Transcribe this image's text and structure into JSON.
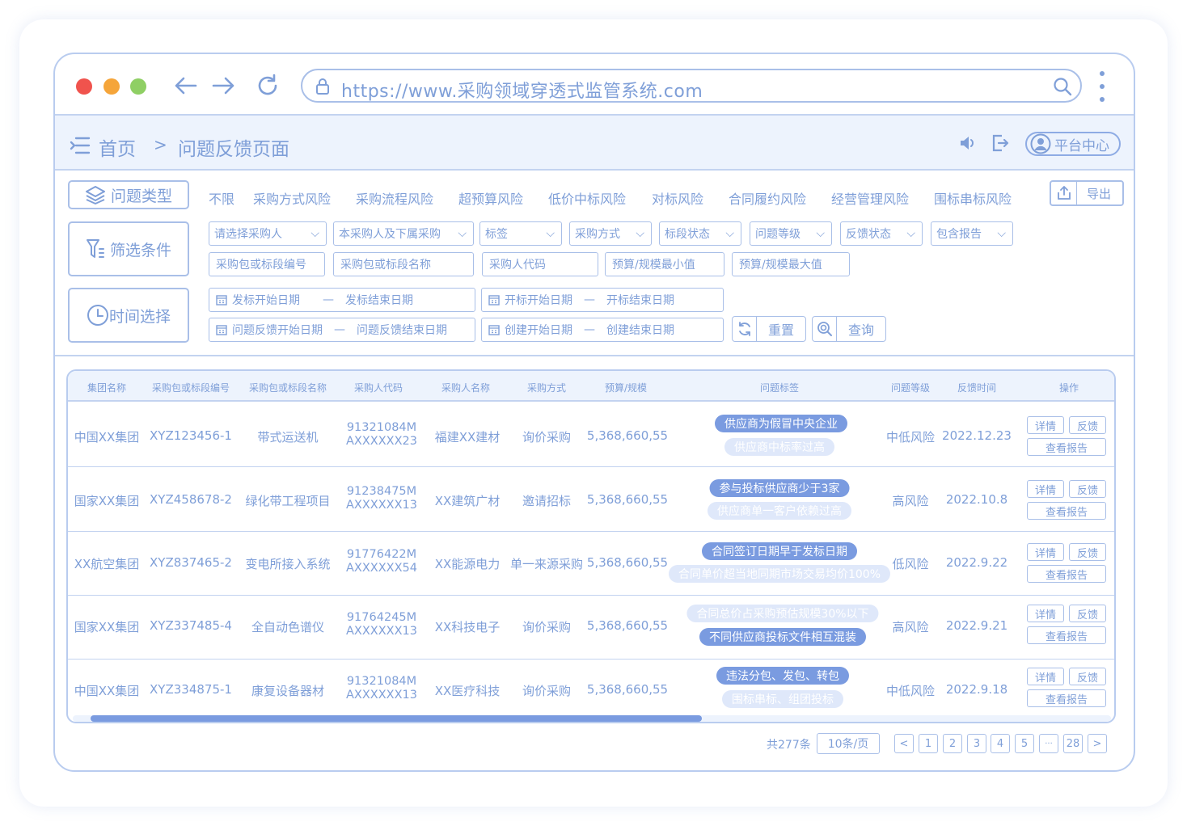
{
  "browser": {
    "url": "https://www.采购领域穿透式监管系统.com",
    "colors": {
      "close": "#f0534d",
      "minimize": "#f5a53a",
      "maximize": "#8fcf64",
      "accent": "#7a9be0"
    }
  },
  "breadcrumb": {
    "home": "首页",
    "separator": ">",
    "current": "问题反馈页面"
  },
  "header": {
    "platform": "平台中心"
  },
  "filters": {
    "problem_type_label": "问题类型",
    "filter_label": "筛选条件",
    "time_label": "时间选择",
    "risk_types": [
      "不限",
      "采购方式风险",
      "采购流程风险",
      "超预算风险",
      "低价中标风险",
      "对标风险",
      "合同履约风险",
      "经营管理风险",
      "围标串标风险"
    ],
    "export_label": "导出",
    "selects": [
      "请选择采购人",
      "本采购人及下属采购",
      "标签",
      "采购方式",
      "标段状态",
      "问题等级",
      "反馈状态",
      "包含报告"
    ],
    "inputs": [
      "采购包或标段编号",
      "采购包或标段名称",
      "采购人代码",
      "预算/规模最小值",
      "预算/规模最大值"
    ],
    "dates": [
      {
        "start": "发标开始日期",
        "end": "发标结束日期"
      },
      {
        "start": "开标开始日期",
        "end": "开标结束日期"
      },
      {
        "start": "问题反馈开始日期",
        "end": "问题反馈结束日期"
      },
      {
        "start": "创建开始日期",
        "end": "创建结束日期"
      }
    ],
    "date_separator": "—",
    "reset_label": "重置",
    "query_label": "查询"
  },
  "table": {
    "headers": [
      "集团名称",
      "采购包或标段编号",
      "采购包或标段名称",
      "采购人代码",
      "采购人名称",
      "采购方式",
      "预算/规模",
      "问题标签",
      "问题等级",
      "反馈时间",
      "操作"
    ],
    "detail_label": "详情",
    "feedback_label": "反馈",
    "report_label": "查看报告",
    "rows": [
      {
        "group": "中国XX集团",
        "code": "XYZ123456-1",
        "name": "带式运送机",
        "buyer_code_1": "91321084M",
        "buyer_code_2": "AXXXXXX23",
        "buyer": "福建XX建材",
        "method": "询价采购",
        "budget": "5,368,660,55",
        "tag1": "供应商为假冒中央企业",
        "tag2": "供应商中标率过高",
        "tag1_dark": true,
        "tag2_dark": false,
        "level": "中低风险",
        "date": "2022.12.23"
      },
      {
        "group": "国家XX集团",
        "code": "XYZ458678-2",
        "name": "绿化带工程项目",
        "buyer_code_1": "91238475M",
        "buyer_code_2": "AXXXXXX13",
        "buyer": "XX建筑广材",
        "method": "邀请招标",
        "budget": "5,368,660,55",
        "tag1": "参与投标供应商少于3家",
        "tag2": "供应商单一客户依赖过高",
        "tag1_dark": true,
        "tag2_dark": false,
        "level": "高风险",
        "date": "2022.10.8"
      },
      {
        "group": "XX航空集团",
        "code": "XYZ837465-2",
        "name": "变电所接入系统",
        "buyer_code_1": "91776422M",
        "buyer_code_2": "AXXXXXX54",
        "buyer": "XX能源电力",
        "method": "单一来源采购",
        "budget": "5,368,660,55",
        "tag1": "合同签订日期早于发标日期",
        "tag2": "合同单价超当地同期市场交易均价100%",
        "tag1_dark": true,
        "tag2_dark": false,
        "level": "低风险",
        "date": "2022.9.22"
      },
      {
        "group": "国家XX集团",
        "code": "XYZ337485-4",
        "name": "全自动色谱仪",
        "buyer_code_1": "91764245M",
        "buyer_code_2": "AXXXXXX13",
        "buyer": "XX科技电子",
        "method": "询价采购",
        "budget": "5,368,660,55",
        "tag1": "合同总价占采购预估规模30%以下",
        "tag2": "不同供应商投标文件相互混装",
        "tag1_dark": false,
        "tag2_dark": true,
        "level": "高风险",
        "date": "2022.9.21"
      },
      {
        "group": "中国XX集团",
        "code": "XYZ334875-1",
        "name": "康复设备器材",
        "buyer_code_1": "91321084M",
        "buyer_code_2": "AXXXXXX13",
        "buyer": "XX医疗科技",
        "method": "询价采购",
        "budget": "5,368,660,55",
        "tag1": "违法分包、发包、转包",
        "tag2": "围标串标、组团投标",
        "tag1_dark": true,
        "tag2_dark": false,
        "level": "中低风险",
        "date": "2022.9.18"
      }
    ]
  },
  "pagination": {
    "total": "共277条",
    "page_size": "10条/页",
    "prev": "<",
    "next": ">",
    "pages": [
      "1",
      "2",
      "3",
      "4",
      "5",
      "···",
      "28"
    ]
  },
  "icons": {
    "back": "arrow-left-icon",
    "forward": "arrow-right-icon",
    "refresh": "refresh-icon",
    "lock": "lock-icon",
    "search": "search-icon",
    "menu": "menu-icon",
    "volume": "speaker-icon",
    "logout": "logout-icon",
    "user": "user-icon",
    "layers": "layers-icon",
    "filter": "filter-icon",
    "clock": "clock-icon",
    "export": "export-icon",
    "calendar": "calendar-icon",
    "reset": "reset-icon",
    "query": "query-icon"
  }
}
